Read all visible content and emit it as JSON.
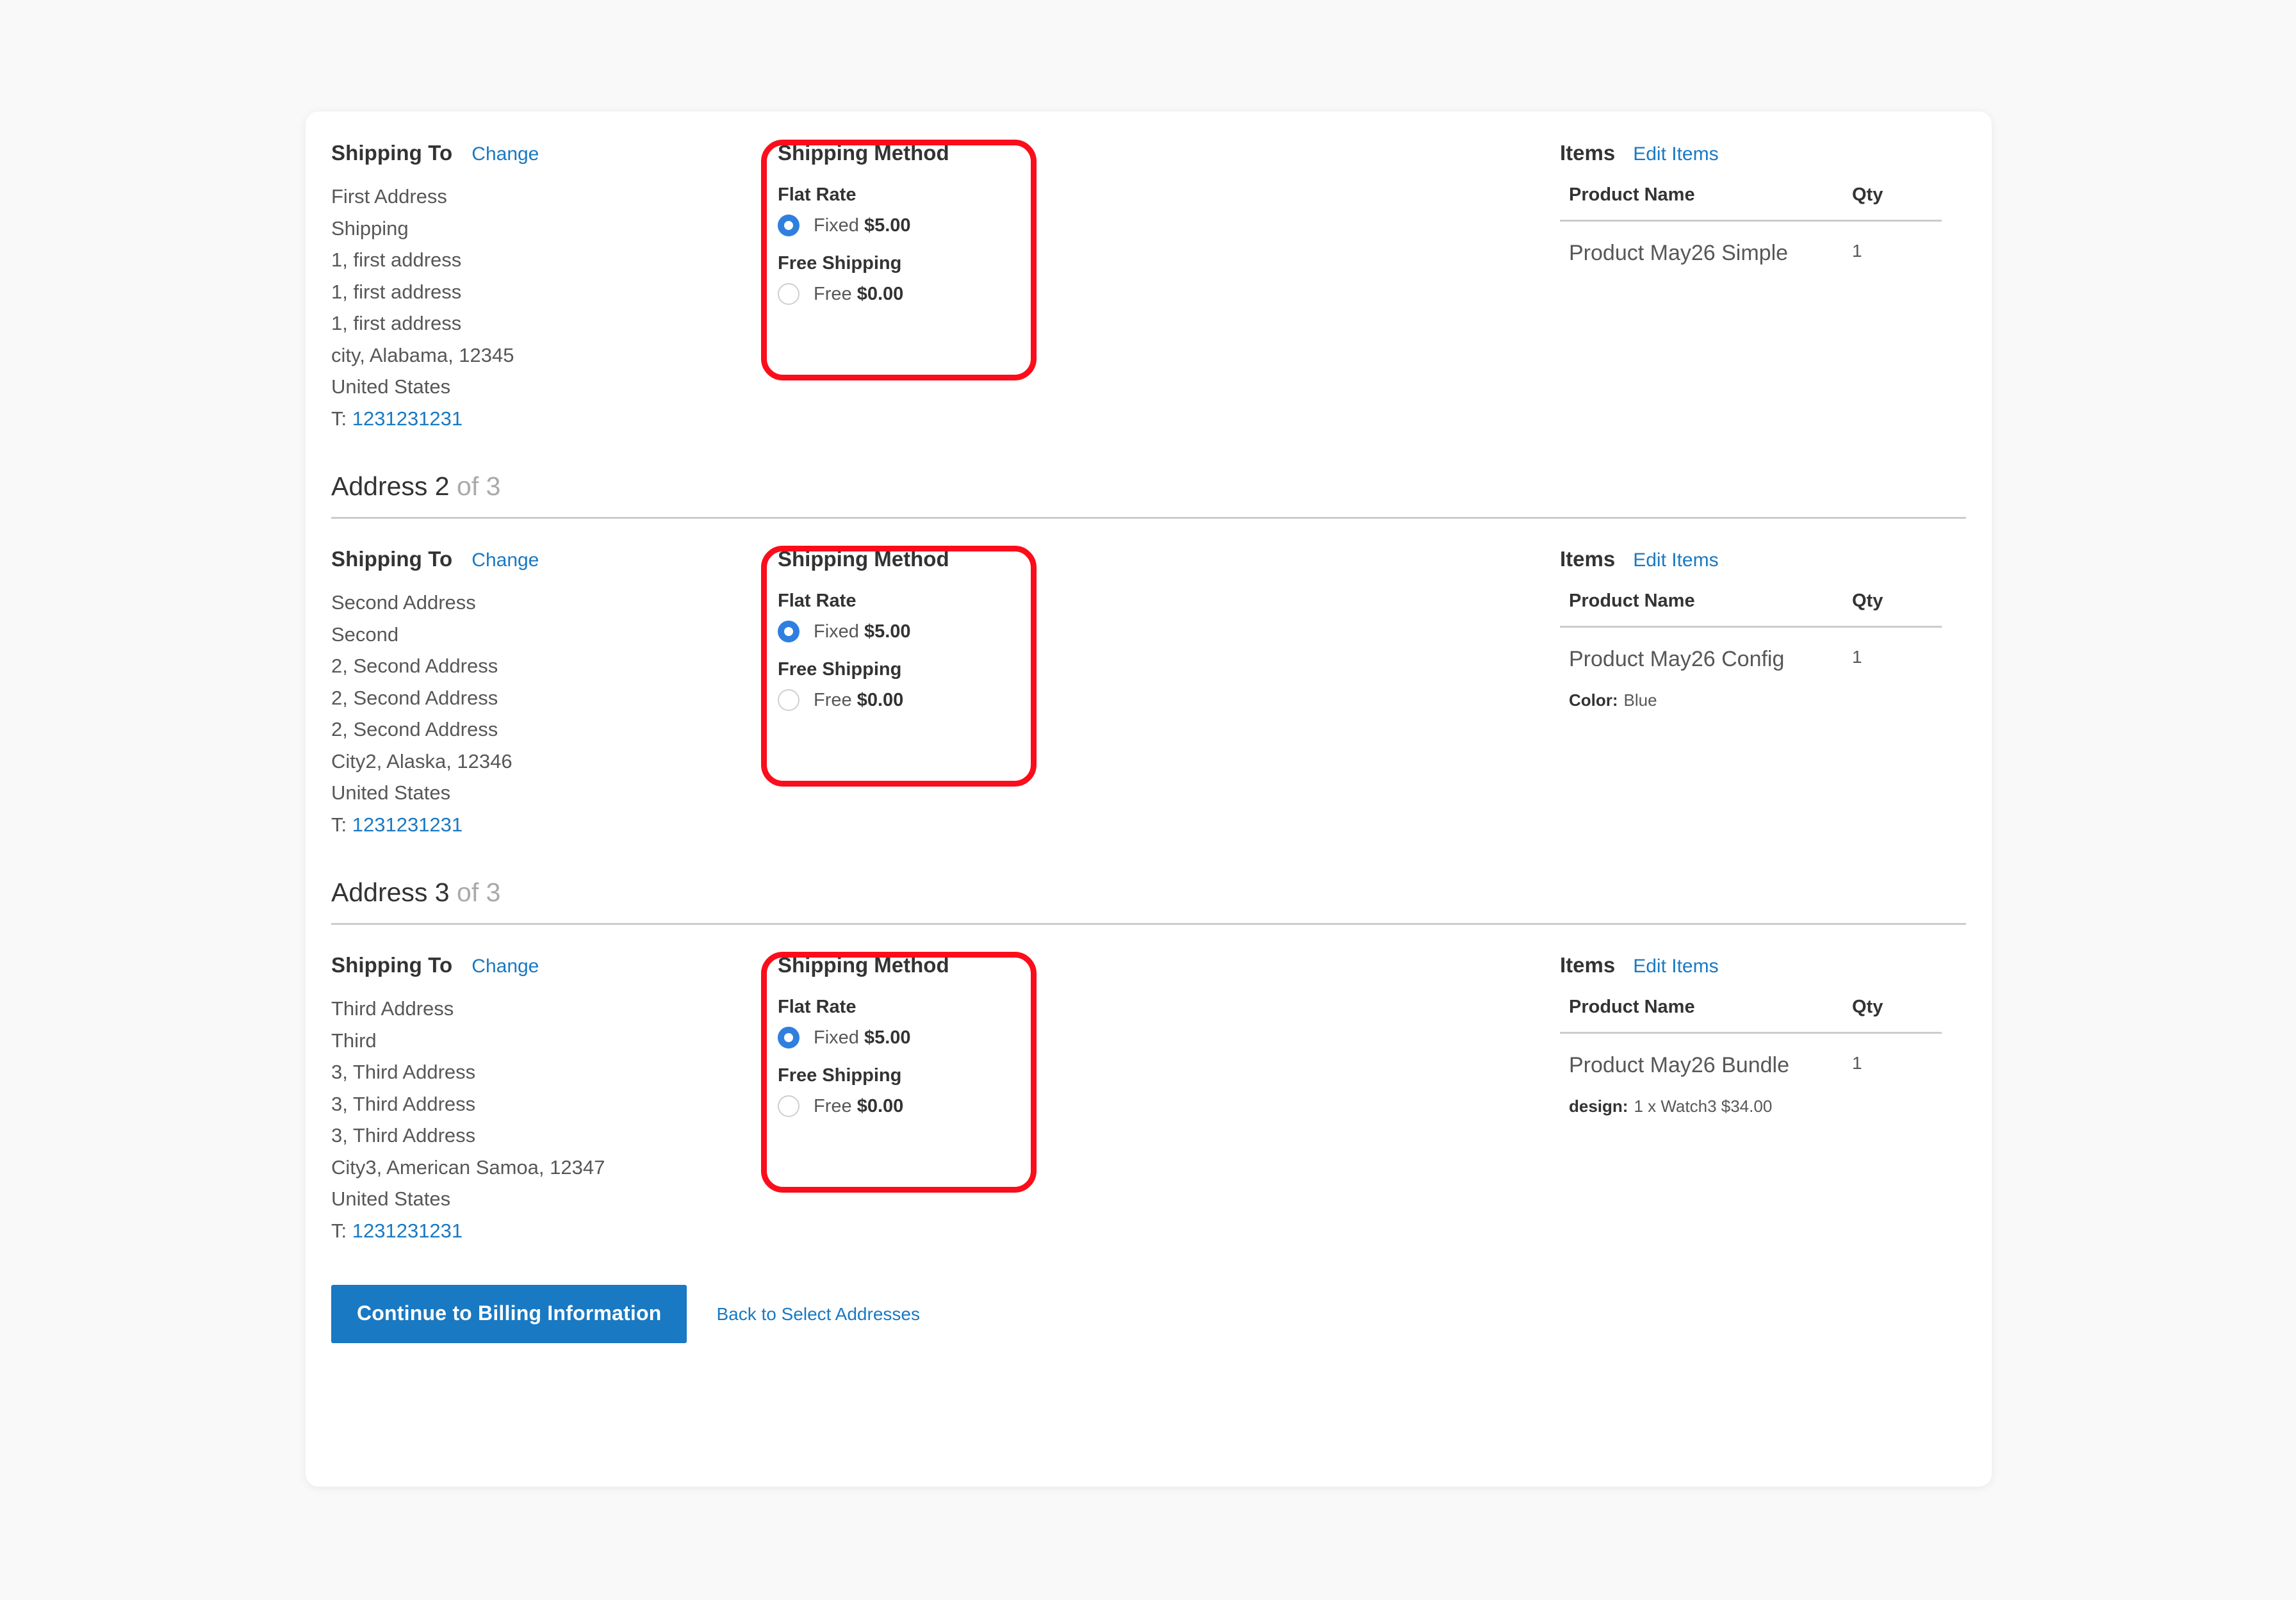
{
  "page": {
    "background_color": "#f9f9f9",
    "card_background": "#ffffff",
    "accent_color": "#1979c3",
    "radio_selected_color": "#2f7fe0",
    "annotation_color": "#fc0d1b"
  },
  "labels": {
    "shipping_to_title": "Shipping To",
    "change_link": "Change",
    "shipping_method_title": "Shipping Method",
    "items_title": "Items",
    "edit_items_link": "Edit Items",
    "col_product_name": "Product Name",
    "col_qty": "Qty",
    "tel_prefix": "T:"
  },
  "shipments": [
    {
      "heading": null,
      "address": {
        "lines": [
          "First Address",
          "Shipping",
          "1, first address",
          "1, first address",
          "1, first address",
          "city, Alabama, 12345",
          "United States"
        ],
        "telephone": "1231231231"
      },
      "shipping_method": {
        "carriers": [
          {
            "name": "Flat Rate",
            "options": [
              {
                "label": "Fixed",
                "price": "$5.00",
                "selected": true
              }
            ]
          },
          {
            "name": "Free Shipping",
            "options": [
              {
                "label": "Free",
                "price": "$0.00",
                "selected": false
              }
            ]
          }
        ],
        "highlighted": true
      },
      "items": [
        {
          "product_name": "Product May26 Simple",
          "qty": "1",
          "options": []
        }
      ]
    },
    {
      "heading": {
        "text": "Address 2",
        "suffix": "of 3"
      },
      "address": {
        "lines": [
          "Second Address",
          "Second",
          "2, Second Address",
          "2, Second Address",
          "2, Second Address",
          "City2, Alaska, 12346",
          "United States"
        ],
        "telephone": "1231231231"
      },
      "shipping_method": {
        "carriers": [
          {
            "name": "Flat Rate",
            "options": [
              {
                "label": "Fixed",
                "price": "$5.00",
                "selected": true
              }
            ]
          },
          {
            "name": "Free Shipping",
            "options": [
              {
                "label": "Free",
                "price": "$0.00",
                "selected": false
              }
            ]
          }
        ],
        "highlighted": true
      },
      "items": [
        {
          "product_name": "Product May26 Config",
          "qty": "1",
          "options": [
            {
              "label": "Color:",
              "value": "Blue"
            }
          ]
        }
      ]
    },
    {
      "heading": {
        "text": "Address 3",
        "suffix": "of 3"
      },
      "address": {
        "lines": [
          "Third Address",
          "Third",
          "3, Third Address",
          "3, Third Address",
          "3, Third Address",
          "City3, American Samoa, 12347",
          "United States"
        ],
        "telephone": "1231231231"
      },
      "shipping_method": {
        "carriers": [
          {
            "name": "Flat Rate",
            "options": [
              {
                "label": "Fixed",
                "price": "$5.00",
                "selected": true
              }
            ]
          },
          {
            "name": "Free Shipping",
            "options": [
              {
                "label": "Free",
                "price": "$0.00",
                "selected": false
              }
            ]
          }
        ],
        "highlighted": true
      },
      "items": [
        {
          "product_name": "Product May26 Bundle",
          "qty": "1",
          "options": [
            {
              "label": "design:",
              "value": "1 x Watch3 $34.00"
            }
          ]
        }
      ]
    }
  ],
  "actions": {
    "primary_label": "Continue to Billing Information",
    "secondary_label": "Back to Select Addresses"
  }
}
